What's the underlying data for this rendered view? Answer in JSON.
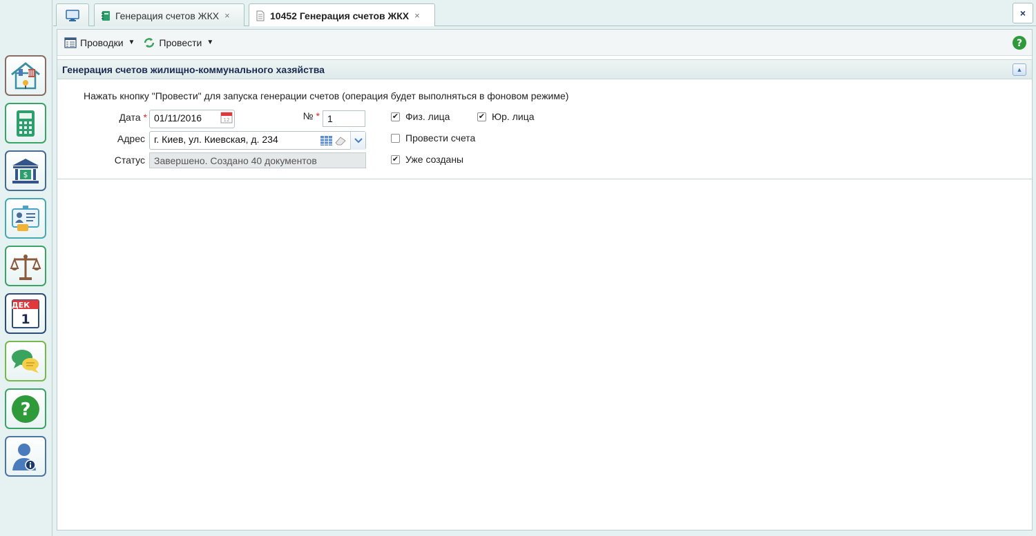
{
  "tabs": [
    {
      "label": ""
    },
    {
      "label": "Генерация счетов ЖКХ"
    },
    {
      "label": "10452 Генерация счетов ЖКХ"
    }
  ],
  "tab_close_glyph": "×",
  "window_close_glyph": "×",
  "sidebar": {
    "items": [
      {
        "icon": "utilities-house-icon"
      },
      {
        "icon": "calculator-icon"
      },
      {
        "icon": "bank-icon"
      },
      {
        "icon": "contacts-card-icon"
      },
      {
        "icon": "scales-icon"
      },
      {
        "icon": "calendar-icon",
        "month": "ДЕК",
        "day": "1"
      },
      {
        "icon": "chat-icon"
      },
      {
        "icon": "help-icon"
      },
      {
        "icon": "user-info-icon"
      }
    ]
  },
  "toolbar": {
    "postings_label": "Проводки",
    "run_label": "Провести"
  },
  "section": {
    "title": "Генерация счетов жилищно-коммунального хазяйства",
    "hint": "Нажать кнопку \"Провести\" для запуска генерации счетов (операция будет выполняться в фоновом режиме)"
  },
  "form": {
    "date_label": "Дата",
    "date_value": "01/11/2016",
    "number_label": "№",
    "number_value": "1",
    "required_mark": "*",
    "address_label": "Адрес",
    "address_value": "г. Киев, ул. Киевская, д. 234",
    "status_label": "Статус",
    "status_value": "Завершено. Создано 40 документов"
  },
  "checkboxes": {
    "individuals": {
      "label": "Физ. лица",
      "checked": true
    },
    "legal": {
      "label": "Юр. лица",
      "checked": true
    },
    "post_invoices": {
      "label": "Провести счета",
      "checked": false
    },
    "already_created": {
      "label": "Уже созданы",
      "checked": true
    }
  },
  "check_glyph": "✔",
  "colors": {
    "accent": "#1a2a50",
    "help_green": "#2e9a3a",
    "background": "#e6f1f1"
  }
}
